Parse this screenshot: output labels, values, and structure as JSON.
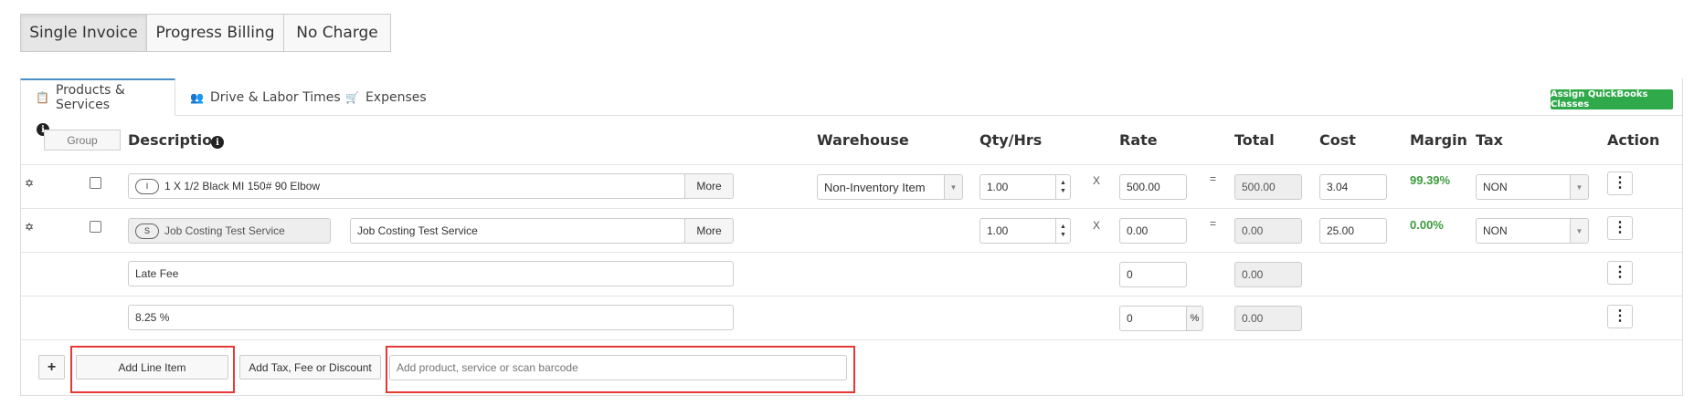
{
  "billing_types": {
    "single_invoice": "Single Invoice",
    "progress_billing": "Progress Billing",
    "no_charge": "No Charge"
  },
  "tabs": {
    "products_services": "Products & Services",
    "drive_labor": "Drive & Labor Times",
    "expenses": "Expenses"
  },
  "assign_qb_classes": "Assign QuickBooks Classes",
  "header": {
    "info": "i",
    "group": "Group",
    "description": "Description",
    "warehouse": "Warehouse",
    "qty_hrs": "Qty/Hrs",
    "rate": "Rate",
    "total": "Total",
    "cost": "Cost",
    "margin": "Margin",
    "tax": "Tax",
    "action": "Action"
  },
  "rows": [
    {
      "type_badge": "I",
      "description": "1 X 1/2 Black MI 150# 90 Elbow",
      "more": "More",
      "warehouse": "Non-Inventory Item",
      "qty": "1.00",
      "x": "X",
      "rate": "500.00",
      "eq": "=",
      "total": "500.00",
      "cost": "3.04",
      "margin": "99.39%",
      "tax": "NON"
    },
    {
      "type_badge": "S",
      "service_name": "Job Costing Test Service",
      "description": "Job Costing Test Service",
      "more": "More",
      "qty": "1.00",
      "x": "X",
      "rate": "0.00",
      "eq": "=",
      "total": "0.00",
      "cost": "25.00",
      "margin": "0.00%",
      "tax": "NON"
    },
    {
      "description": "Late Fee",
      "rate": "0",
      "total": "0.00"
    },
    {
      "description": "8.25 %",
      "rate": "0",
      "rate_suffix": "%",
      "total": "0.00"
    }
  ],
  "footer": {
    "plus": "+",
    "add_line_item": "Add Line Item",
    "add_tax_fee_discount": "Add Tax, Fee or Discount",
    "search_placeholder": "Add product, service or scan barcode"
  },
  "colors": {
    "accent_green": "#2fa94a",
    "margin_green": "#3c9a3c",
    "highlight_red": "#e53935",
    "tab_accent": "#4a90c8"
  }
}
